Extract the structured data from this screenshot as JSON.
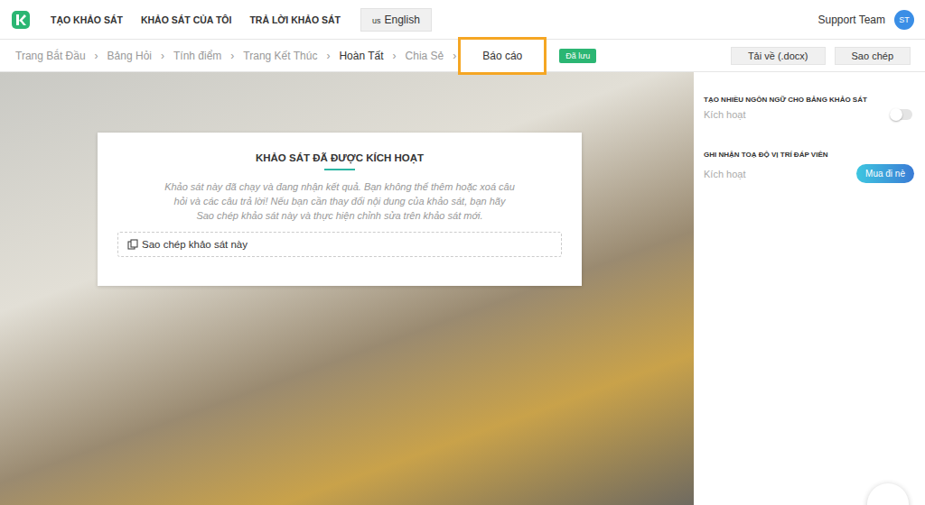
{
  "topbar": {
    "nav": [
      "TẠO KHẢO SÁT",
      "KHẢO SÁT CỦA TÔI",
      "TRẢ LỜI KHẢO SÁT"
    ],
    "language": {
      "flag": "us",
      "label": "English"
    },
    "user": {
      "name": "Support Team",
      "initials": "ST"
    }
  },
  "breadcrumb": {
    "separator": "›",
    "items": [
      {
        "label": "Trang Bắt Đầu",
        "selected": false,
        "emphasized": false
      },
      {
        "label": "Bảng Hỏi",
        "selected": false,
        "emphasized": false
      },
      {
        "label": "Tính điểm",
        "selected": false,
        "emphasized": false
      },
      {
        "label": "Trang Kết Thúc",
        "selected": false,
        "emphasized": false
      },
      {
        "label": "Hoàn Tất",
        "selected": false,
        "emphasized": true
      },
      {
        "label": "Chia Sẻ",
        "selected": false,
        "emphasized": false
      },
      {
        "label": "Báo cáo",
        "selected": true,
        "emphasized": true
      }
    ],
    "badge": "Đã lưu"
  },
  "actions": [
    "Tải về (.docx)",
    "Sao chép"
  ],
  "card": {
    "title": "KHẢO SÁT ĐÃ ĐƯỢC KÍCH HOẠT",
    "message": "Khảo sát này đã chạy và đang nhận kết quả. Bạn không thể thêm hoặc xoá câu hỏi và các câu trả lời! Nếu bạn cần thay đổi nội dung của khảo sát, bạn hãy Sao chép khảo sát này và thực hiện chỉnh sửa trên khảo sát mới.",
    "button": "Sao chép khảo sát này"
  },
  "settings": [
    {
      "title": "TẠO NHIỀU NGÔN NGỮ CHO BẢNG KHẢO SÁT",
      "label": "Kích hoạt",
      "kind": "toggle",
      "on": false
    },
    {
      "title": "GHI NHẬN TOẠ ĐỘ VỊ TRÍ ĐÁP VIÊN",
      "label": "Kích hoạt",
      "kind": "purchase",
      "button": "Mua đi nè"
    }
  ]
}
